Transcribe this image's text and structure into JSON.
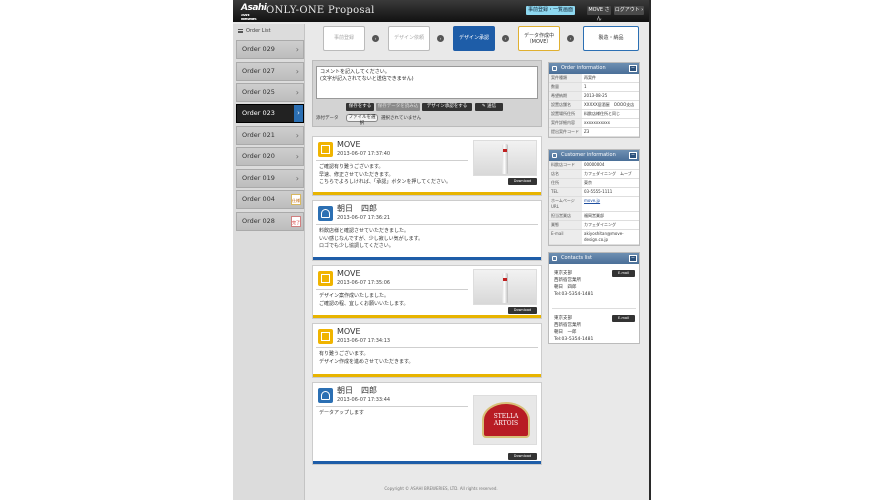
{
  "header": {
    "logo_main": "Asahi",
    "logo_sub": "ASAHI BREWERIES",
    "brand": "ONLY-ONE Proposal",
    "proposals_btn": "事前登録・一覧画面",
    "user_btn": "MOVE さん",
    "logout_btn": "ログアウト ›"
  },
  "sidebar": {
    "title": "Order List",
    "items": [
      {
        "label": "Order 029",
        "badge": ""
      },
      {
        "label": "Order 027",
        "badge": ""
      },
      {
        "label": "Order 025",
        "badge": ""
      },
      {
        "label": "Order 023",
        "badge": ""
      },
      {
        "label": "Order 021",
        "badge": ""
      },
      {
        "label": "Order 020",
        "badge": ""
      },
      {
        "label": "Order 019",
        "badge": ""
      },
      {
        "label": "Order 004",
        "badge": "仕様"
      },
      {
        "label": "Order 028",
        "badge": "完了"
      }
    ]
  },
  "steps": {
    "s1": "事前登録",
    "s2": "デザイン依頼",
    "s3": "デザイン承認",
    "s4_line1": "データ作成中",
    "s4_line2": "（MOVE）",
    "s5": "製造・納品"
  },
  "comment": {
    "textarea_line1": "コメントを記入してください。",
    "textarea_line2": "(文字が記入されてないと送信できません)",
    "btn_save": "保存をする",
    "btn_disabled": "保存データを読み込む",
    "btn_approve": "デザイン承認をする",
    "btn_send": "✎ 送信",
    "attach_label": "添付データ",
    "file_btn": "ファイルを選択",
    "file_none": "選択されていません"
  },
  "messages": [
    {
      "name": "MOVE",
      "time": "2013-06-07 17:37:40",
      "body": "ご確認有り難うございます。\n早速、修正させていただきます。\nこちらでよろしければ、「承認」ボタンを押してください。",
      "download": "Download"
    },
    {
      "name": "朝日　四郎",
      "time": "2013-06-07 17:36:21",
      "body": "料飲店様と確認させていただきました。\nいい感じなんですが、少し寂しい気がします。\nロゴでも少し協調してください。",
      "download": ""
    },
    {
      "name": "MOVE",
      "time": "2013-06-07 17:35:06",
      "body": "デザイン案作成いたしました。\nご確認の程、宜しくお願いいたします。",
      "download": "Download"
    },
    {
      "name": "MOVE",
      "time": "2013-06-07 17:34:13",
      "body": "有り難うございます。\nデザイン作成を進めさせていただきます。",
      "download": ""
    },
    {
      "name": "朝日　四郎",
      "time": "2013-06-07 17:33:44",
      "body": "データアップします",
      "download": "Download",
      "sign_line1": "STELLA",
      "sign_line2": "ARTOIS"
    }
  ],
  "order_info": {
    "title": "Order information",
    "rows": [
      {
        "k": "案件種類",
        "v": "再案件"
      },
      {
        "k": "数量",
        "v": "1"
      },
      {
        "k": "希望納期",
        "v": "2013-08-25"
      },
      {
        "k": "設置店舗名",
        "v": "XXXXX居酒屋　OOOO支店"
      },
      {
        "k": "設置場所住所",
        "v": "料飲店様住所と同じ"
      },
      {
        "k": "案件詳細内容",
        "v": "xxxxxxxxxxx"
      },
      {
        "k": "提出案件コード",
        "v": "Z3"
      }
    ]
  },
  "customer_info": {
    "title": "Customer information",
    "rows": [
      {
        "k": "料飲店コード",
        "v": "00000004"
      },
      {
        "k": "店名",
        "v": "カフェダイニング　ムーブ"
      },
      {
        "k": "住所",
        "v": "東京"
      },
      {
        "k": "TEL",
        "v": "03-5555-1111"
      },
      {
        "k": "ホームページURL",
        "v": "move.jp",
        "link": true
      },
      {
        "k": "担当営業店",
        "v": "福岡営業部"
      },
      {
        "k": "業態",
        "v": "カフェダイニング"
      },
      {
        "k": "E-mail",
        "v": "akiyoshitan@move-design.co.jp"
      }
    ]
  },
  "contacts": {
    "title": "Contacts list",
    "email_btn": "E-mail",
    "items": [
      {
        "l1": "東京支部",
        "l2": "西新宿営業所",
        "l3": "朝日　四郎",
        "l4": "Tel:03-5354-1481"
      },
      {
        "l1": "東京支部",
        "l2": "西新宿営業所",
        "l3": "朝日　一郎",
        "l4": "Tel:03-5354-1481"
      }
    ]
  },
  "footer": "Copyright © ASAHI BREWERIES, LTD. All rights reserved.",
  "colors": {
    "accent_blue": "#1e5da8",
    "move_yellow": "#e8b400"
  }
}
